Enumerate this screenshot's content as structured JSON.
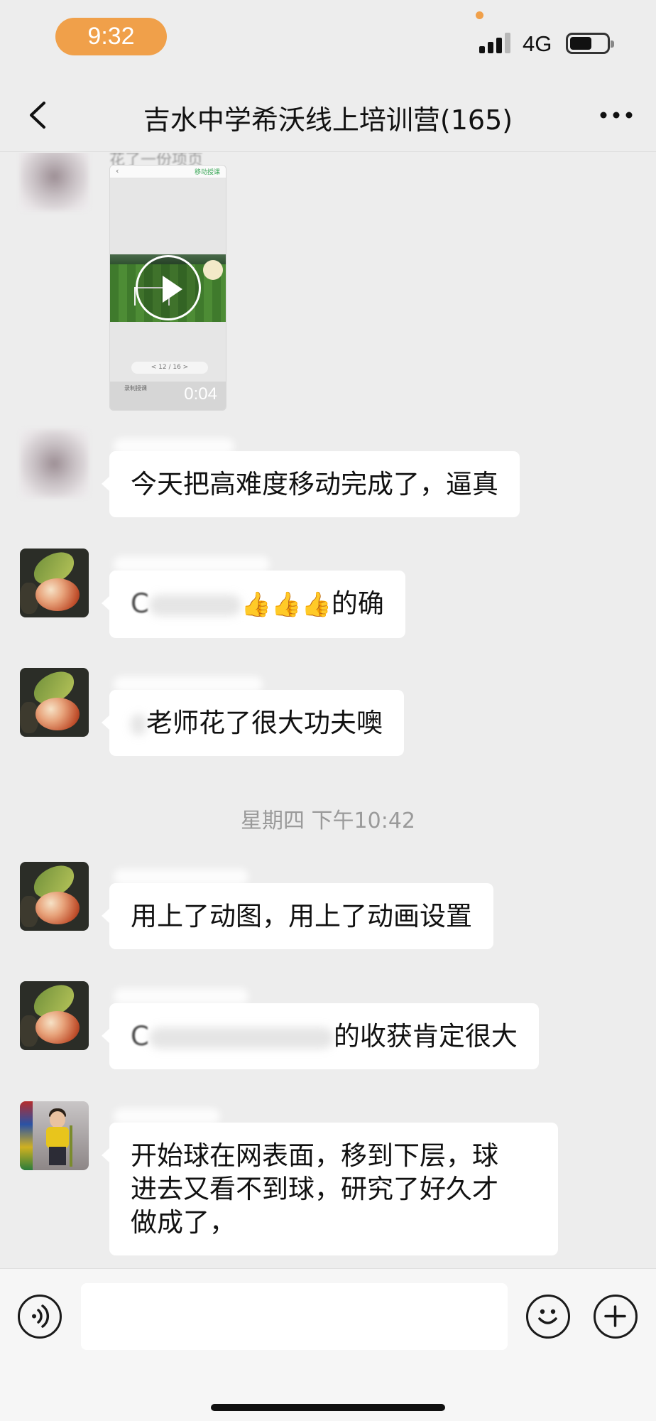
{
  "status_bar": {
    "time": "9:32",
    "network": "4G",
    "signal_bars_filled": 3,
    "signal_bars_total": 4,
    "battery_level": 0.6
  },
  "nav": {
    "title": "吉水中学希沃线上培训营(165)",
    "back_icon": "chevron-left-icon",
    "more_icon": "more-dots-icon"
  },
  "messages": [
    {
      "type": "video",
      "sender_avatar": "blurred",
      "caption_partial": "花了一份项页",
      "thumbnail": {
        "top_right_label": "移动授课",
        "pager": "< 12 / 16 >",
        "bottom_left_label": "录制授课"
      },
      "duration": "0:04"
    },
    {
      "type": "text",
      "sender_avatar": "blurred",
      "text": "今天把高难度移动完成了，逼真"
    },
    {
      "type": "text",
      "sender_avatar": "mango",
      "text_visible_suffix": "的确",
      "text_visible_prefix": "C",
      "emoji": [
        "👍",
        "👍",
        "👍"
      ]
    },
    {
      "type": "text",
      "sender_avatar": "mango",
      "text": "老师花了很大功夫噢"
    },
    {
      "type": "timestamp",
      "text": "星期四 下午10:42"
    },
    {
      "type": "text",
      "sender_avatar": "mango",
      "text": "用上了动图，用上了动画设置"
    },
    {
      "type": "text",
      "sender_avatar": "mango",
      "text_visible_prefix": "C",
      "text_visible_suffix": "的收获肯定很大"
    },
    {
      "type": "text",
      "sender_avatar": "kid",
      "lines": [
        "开始球在网表面，移到下层，球",
        "进去又看不到球，研究了好久才",
        "做成了，"
      ]
    }
  ],
  "input_bar": {
    "voice_icon": "voice-icon",
    "emoji_icon": "emoji-smile-icon",
    "add_icon": "plus-icon",
    "input_value": ""
  }
}
